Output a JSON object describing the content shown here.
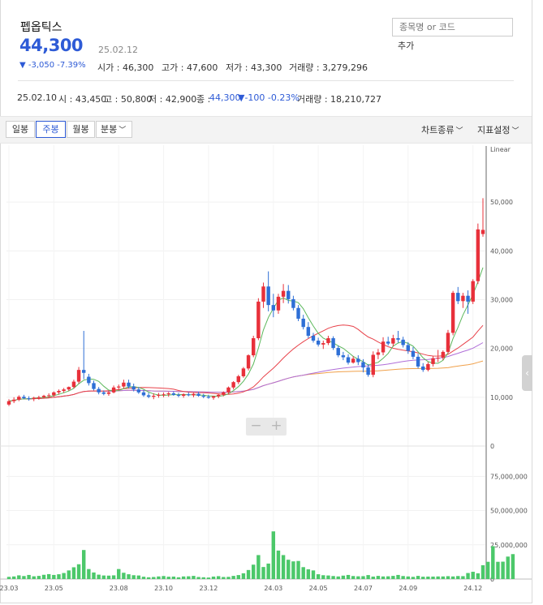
{
  "stock": {
    "name": "펩옵틱스",
    "price": "44,300",
    "date": "25.02.12",
    "change": "▼ -3,050 -7.39%",
    "open": "시가 : 46,300",
    "high": "고가 : 47,600",
    "low": "저가 : 43,300",
    "volume": "거래량 : 3,279,296"
  },
  "search": {
    "placeholder": "종목명 or 코드",
    "add_label": "추가"
  },
  "hover": {
    "date": "25.02.10",
    "open": "시 : 43,450",
    "high": "고 : 50,800",
    "low": "저 : 42,900",
    "close_label": "종 :",
    "close": "44,300",
    "change": "▼-100 -0.23%",
    "volume": "거래량 : 18,210,727"
  },
  "toolbar": {
    "periods": [
      "일봉",
      "주봉",
      "월봉",
      "분봉"
    ],
    "active_period": "주봉",
    "chart_type": "차트종류",
    "indicator": "지표설정"
  },
  "colors": {
    "up": "#e8303a",
    "down": "#2e6fd6",
    "ma5": "#5cb85c",
    "ma20": "#e8424a",
    "ma60": "#b06ed8",
    "ma120": "#f0a04a",
    "volume": "#4cc86a",
    "price": "#2e5bd6"
  },
  "chart_data": {
    "type": "candlestick",
    "price_scale": "Linear",
    "y_ticks": [
      "50,000",
      "40,000",
      "30,000",
      "20,000",
      "10,000",
      "0"
    ],
    "y_tick_values": [
      50000,
      40000,
      30000,
      20000,
      10000,
      0
    ],
    "volume_ticks": [
      "75,000,000",
      "50,000,000",
      "25,000,000",
      "0"
    ],
    "volume_tick_values": [
      75000000,
      50000000,
      25000000,
      0
    ],
    "x_ticks": [
      {
        "label": "23.03",
        "i": 0
      },
      {
        "label": "23.05",
        "i": 9
      },
      {
        "label": "23.08",
        "i": 22
      },
      {
        "label": "23.10",
        "i": 31
      },
      {
        "label": "23.12",
        "i": 40
      },
      {
        "label": "24.03",
        "i": 53
      },
      {
        "label": "24.05",
        "i": 62
      },
      {
        "label": "24.07",
        "i": 71
      },
      {
        "label": "24.09",
        "i": 80
      },
      {
        "label": "24.12",
        "i": 93
      }
    ],
    "weekly_ohlc": [
      [
        8500,
        9600,
        8200,
        9200
      ],
      [
        9200,
        10000,
        8800,
        9500
      ],
      [
        9500,
        10400,
        9200,
        10100
      ],
      [
        10100,
        10500,
        9600,
        9800
      ],
      [
        9800,
        10200,
        9300,
        9700
      ],
      [
        9700,
        10100,
        9200,
        9900
      ],
      [
        9900,
        10300,
        9500,
        10000
      ],
      [
        10000,
        10500,
        9700,
        10300
      ],
      [
        10300,
        10800,
        9900,
        10400
      ],
      [
        10400,
        11200,
        10100,
        11000
      ],
      [
        11000,
        11600,
        10600,
        11300
      ],
      [
        11300,
        11900,
        10900,
        11600
      ],
      [
        11600,
        12200,
        11300,
        12100
      ],
      [
        12100,
        13600,
        11800,
        13200
      ],
      [
        13200,
        16200,
        12800,
        15600
      ],
      [
        15600,
        23600,
        13700,
        15000
      ],
      [
        14200,
        14800,
        12400,
        12900
      ],
      [
        12900,
        13400,
        11400,
        11700
      ],
      [
        11700,
        12100,
        10600,
        11000
      ],
      [
        11000,
        11400,
        10400,
        10700
      ],
      [
        10700,
        11300,
        10300,
        11000
      ],
      [
        11000,
        12400,
        10800,
        12000
      ],
      [
        12000,
        12600,
        11400,
        12200
      ],
      [
        12200,
        13600,
        11800,
        13000
      ],
      [
        13000,
        13600,
        11800,
        12200
      ],
      [
        12200,
        12800,
        11200,
        11600
      ],
      [
        11600,
        12100,
        10700,
        11000
      ],
      [
        11000,
        11500,
        10100,
        10400
      ],
      [
        10400,
        10900,
        9800,
        10100
      ],
      [
        10100,
        10800,
        9600,
        10300
      ],
      [
        10300,
        10900,
        9900,
        10500
      ],
      [
        10500,
        11000,
        10000,
        10600
      ],
      [
        10600,
        11100,
        10100,
        10800
      ],
      [
        10800,
        11200,
        10300,
        10500
      ],
      [
        10500,
        10900,
        10000,
        10300
      ],
      [
        10300,
        10800,
        9900,
        10600
      ],
      [
        10600,
        11000,
        10200,
        10400
      ],
      [
        10400,
        10900,
        10000,
        10700
      ],
      [
        10700,
        11100,
        10100,
        10300
      ],
      [
        10300,
        10700,
        9800,
        10100
      ],
      [
        10100,
        10500,
        9700,
        9900
      ],
      [
        9900,
        10300,
        9500,
        10200
      ],
      [
        10200,
        10700,
        9800,
        10500
      ],
      [
        10500,
        11200,
        10200,
        11000
      ],
      [
        11000,
        12200,
        10700,
        12000
      ],
      [
        12000,
        13300,
        11600,
        13100
      ],
      [
        13100,
        14600,
        12700,
        14300
      ],
      [
        14300,
        16200,
        14000,
        15900
      ],
      [
        15900,
        18800,
        15500,
        18600
      ],
      [
        18600,
        22600,
        18200,
        22100
      ],
      [
        22100,
        30300,
        21700,
        29600
      ],
      [
        29600,
        33500,
        28300,
        32700
      ],
      [
        32700,
        35800,
        27600,
        28900
      ],
      [
        28900,
        31200,
        26400,
        27800
      ],
      [
        27800,
        31200,
        27100,
        30600
      ],
      [
        30600,
        33200,
        29300,
        31800
      ],
      [
        31800,
        33000,
        29200,
        30100
      ],
      [
        30100,
        30800,
        27800,
        28300
      ],
      [
        28300,
        28900,
        25600,
        26100
      ],
      [
        26100,
        26900,
        23900,
        24400
      ],
      [
        24400,
        25400,
        22100,
        22600
      ],
      [
        22600,
        23200,
        21200,
        21600
      ],
      [
        21600,
        22200,
        20400,
        20800
      ],
      [
        20800,
        21600,
        19900,
        21100
      ],
      [
        21100,
        22600,
        20700,
        22100
      ],
      [
        22100,
        22500,
        19700,
        20100
      ],
      [
        20100,
        20600,
        18200,
        18600
      ],
      [
        18600,
        19300,
        17600,
        18200
      ],
      [
        18200,
        18800,
        16700,
        17100
      ],
      [
        17100,
        18400,
        16900,
        17900
      ],
      [
        17900,
        18600,
        16600,
        17200
      ],
      [
        17200,
        17800,
        15100,
        16100
      ],
      [
        16100,
        16800,
        14200,
        14600
      ],
      [
        14600,
        19400,
        14100,
        18700
      ],
      [
        18700,
        19900,
        17800,
        19200
      ],
      [
        19200,
        22300,
        18600,
        21400
      ],
      [
        21400,
        22400,
        20600,
        21000
      ],
      [
        21000,
        22800,
        20400,
        22100
      ],
      [
        22100,
        23600,
        21200,
        21800
      ],
      [
        21800,
        22400,
        20200,
        20700
      ],
      [
        20700,
        21300,
        18900,
        19500
      ],
      [
        19500,
        20300,
        17800,
        18300
      ],
      [
        18300,
        18900,
        15900,
        16300
      ],
      [
        16300,
        17000,
        15200,
        15600
      ],
      [
        15600,
        17200,
        15300,
        16800
      ],
      [
        16800,
        18400,
        16300,
        18000
      ],
      [
        18000,
        19700,
        17200,
        18100
      ],
      [
        18100,
        19600,
        17600,
        19300
      ],
      [
        19300,
        23800,
        19000,
        23200
      ],
      [
        23200,
        31800,
        22700,
        31400
      ],
      [
        31400,
        32600,
        29100,
        29700
      ],
      [
        29700,
        31400,
        28300,
        30800
      ],
      [
        30800,
        31900,
        27100,
        29600
      ],
      [
        29600,
        34200,
        29100,
        33800
      ],
      [
        33800,
        45600,
        33200,
        44400
      ],
      [
        43450,
        50800,
        42900,
        44300
      ]
    ],
    "weekly_volume_millions": [
      1.6,
      1.9,
      2.7,
      2.2,
      3.0,
      2.0,
      2.3,
      3.1,
      3.6,
      3.0,
      3.5,
      4.4,
      6.3,
      8.6,
      10.8,
      21.2,
      7.3,
      4.8,
      3.2,
      2.6,
      2.5,
      2.7,
      7.3,
      4.6,
      3.5,
      2.8,
      2.6,
      1.7,
      1.3,
      1.5,
      1.9,
      2.2,
      1.7,
      1.8,
      1.3,
      1.9,
      2.0,
      2.3,
      1.5,
      1.3,
      1.1,
      1.8,
      2.1,
      1.5,
      1.6,
      2.3,
      2.9,
      4.2,
      6.6,
      10.5,
      17.5,
      8.8,
      11.3,
      34.8,
      20.8,
      17.5,
      14.1,
      12.9,
      13.2,
      8.7,
      7.1,
      6.3,
      3.5,
      2.8,
      2.6,
      2.2,
      1.9,
      2.5,
      3.0,
      2.2,
      2.0,
      2.1,
      2.9,
      1.8,
      2.3,
      1.9,
      2.0,
      2.3,
      3.0,
      2.2,
      1.9,
      1.6,
      2.3,
      1.7,
      1.8,
      1.8,
      1.9,
      1.9,
      2.1,
      1.9,
      2.2,
      2.1,
      4.4,
      5.3,
      4.2,
      10.1,
      12.6,
      24.0,
      12.6,
      12.7,
      16.4,
      18.2
    ]
  }
}
